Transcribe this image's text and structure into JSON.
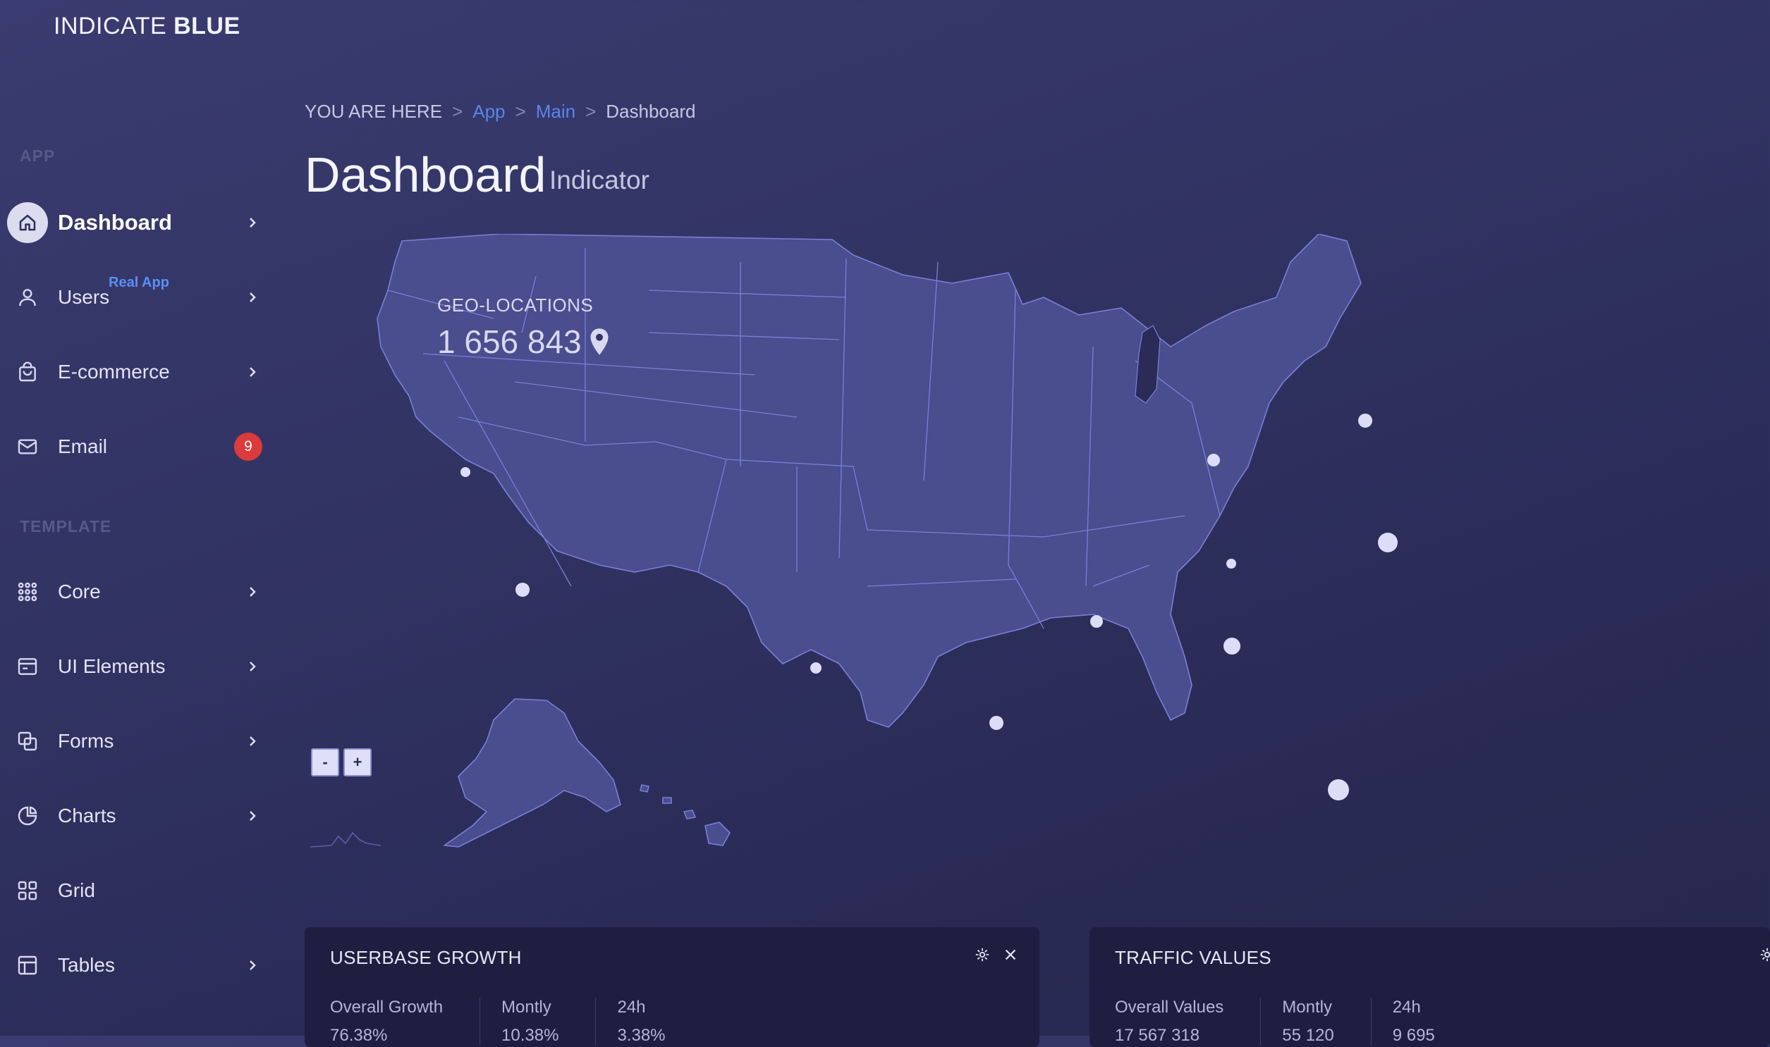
{
  "brand": {
    "name_light": "INDICATE ",
    "name_bold": "BLUE"
  },
  "sidebar": {
    "sections": [
      "APP",
      "TEMPLATE"
    ],
    "items": [
      {
        "label": "Dashboard",
        "icon": "home-icon",
        "active": true
      },
      {
        "label": "Users",
        "icon": "user-icon",
        "tag": "Real App"
      },
      {
        "label": "E-commerce",
        "icon": "bag-icon"
      },
      {
        "label": "Email",
        "icon": "mail-icon",
        "badge": "9"
      },
      {
        "label": "Core",
        "icon": "grid-dots-icon"
      },
      {
        "label": "UI Elements",
        "icon": "window-icon"
      },
      {
        "label": "Forms",
        "icon": "forms-icon"
      },
      {
        "label": "Charts",
        "icon": "pie-chart-icon"
      },
      {
        "label": "Grid",
        "icon": "grid-icon"
      },
      {
        "label": "Tables",
        "icon": "table-icon"
      }
    ]
  },
  "breadcrumb": {
    "prefix": "YOU ARE HERE",
    "items": [
      "App",
      "Main",
      "Dashboard"
    ],
    "separator": ">"
  },
  "page": {
    "title": "Dashboard",
    "subtitle": "Indicator"
  },
  "map": {
    "geo_label": "GEO-LOCATIONS",
    "geo_value": "1 656 843",
    "zoom_out": "-",
    "zoom_in": "+",
    "colors": {
      "land": "#4a4d8e",
      "border": "#7a7fd8",
      "marker": "#dcdef7"
    }
  },
  "cards": [
    {
      "title": "USERBASE GROWTH",
      "stats": [
        {
          "label": "Overall Growth",
          "value": "76.38%"
        },
        {
          "label": "Montly",
          "value": "10.38%"
        },
        {
          "label": "24h",
          "value": "3.38%"
        }
      ]
    },
    {
      "title": "TRAFFIC VALUES",
      "stats": [
        {
          "label": "Overall Values",
          "value": "17 567 318"
        },
        {
          "label": "Montly",
          "value": "55 120"
        },
        {
          "label": "24h",
          "value": "9 695"
        }
      ]
    }
  ]
}
